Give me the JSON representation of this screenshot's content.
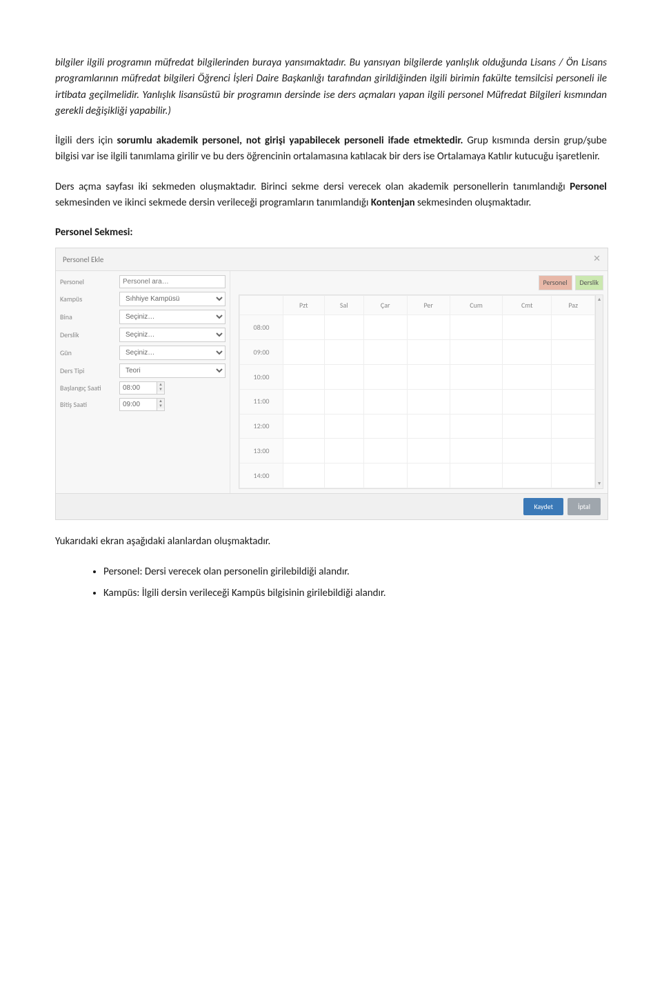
{
  "para1": "bilgiler ilgili programın müfredat bilgilerinden buraya yansımaktadır. Bu yansıyan bilgilerde yanlışlık olduğunda Lisans / Ön Lisans programlarının müfredat bilgileri Öğrenci İşleri Daire Başkanlığı tarafından girildiğinden ilgili birimin fakülte temsilcisi personeli ile irtibata geçilmelidir. Yanlışlık lisansüstü bir programın dersinde ise ders açmaları yapan ilgili personel Müfredat Bilgileri kısmından gerekli değişikliği yapabilir.)",
  "para2_pre": "İlgili ders için ",
  "para2_bold": "sorumlu akademik personel, not girişi yapabilecek personeli ifade etmektedir.",
  "para2_post": " Grup kısmında dersin grup/şube bilgisi var ise ilgili tanımlama girilir ve bu ders öğrencinin ortalamasına katılacak bir ders ise Ortalamaya Katılır kutucuğu işaretlenir.",
  "para3_pre": "Ders açma sayfası iki sekmeden oluşmaktadır. Birinci sekme dersi verecek olan akademik personellerin tanımlandığı ",
  "para3_b1": "Personel",
  "para3_mid": " sekmesinden ve ikinci sekmede dersin verileceği programların tanımlandığı ",
  "para3_b2": "Kontenjan",
  "para3_post": " sekmesinden oluşmaktadır.",
  "section_title": "Personel Sekmesi:",
  "form": {
    "title": "Personel Ekle",
    "close": "✕",
    "labels": {
      "personel": "Personel",
      "kampus": "Kampüs",
      "bina": "Bina",
      "derslik": "Derslik",
      "gun": "Gün",
      "dersTipi": "Ders Tipi",
      "baslangic": "Başlangıç Saati",
      "bitis": "Bitiş Saati"
    },
    "values": {
      "personel_placeholder": "Personel ara…",
      "kampus": "Sıhhiye Kampüsü",
      "bina": "Seçiniz…",
      "derslik": "Seçiniz…",
      "gun": "Seçiniz…",
      "dersTipi": "Teori",
      "baslangic": "08:00",
      "bitis": "09:00"
    },
    "legend": {
      "personel": "Personel",
      "derslik": "Derslik"
    },
    "days": [
      "",
      "Pzt",
      "Sal",
      "Çar",
      "Per",
      "Cum",
      "Cmt",
      "Paz"
    ],
    "times": [
      "08:00",
      "09:00",
      "10:00",
      "11:00",
      "12:00",
      "13:00",
      "14:00"
    ],
    "buttons": {
      "save": "Kaydet",
      "cancel": "İptal"
    }
  },
  "para4": "Yukarıdaki ekran aşağıdaki alanlardan oluşmaktadır.",
  "bullets": [
    "Personel: Dersi verecek olan personelin girilebildiği alandır.",
    "Kampüs: İlgili dersin verileceği Kampüs bilgisinin girilebildiği alandır."
  ]
}
